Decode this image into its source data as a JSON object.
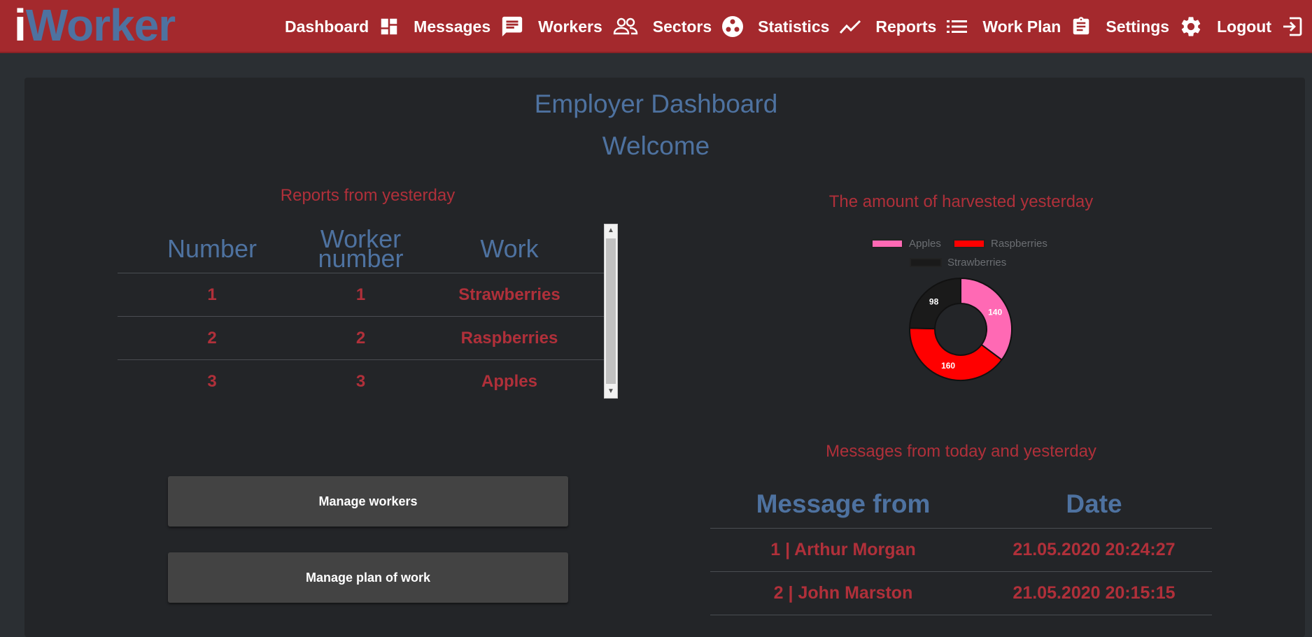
{
  "app": {
    "logo_i": "i",
    "logo_rest": "Worker",
    "colors": {
      "navbar": "#a4292d",
      "accent_blue": "#4e72a0",
      "accent_red": "#b0303a",
      "background": "#2b2f33"
    }
  },
  "nav": {
    "items": [
      {
        "label": "Dashboard",
        "icon": "dashboard-icon"
      },
      {
        "label": "Messages",
        "icon": "message-icon"
      },
      {
        "label": "Workers",
        "icon": "people-icon"
      },
      {
        "label": "Sectors",
        "icon": "sectors-icon"
      },
      {
        "label": "Statistics",
        "icon": "trend-icon"
      },
      {
        "label": "Reports",
        "icon": "list-icon"
      },
      {
        "label": "Work Plan",
        "icon": "clipboard-icon"
      },
      {
        "label": "Settings",
        "icon": "gear-icon"
      },
      {
        "label": "Logout",
        "icon": "logout-icon"
      }
    ]
  },
  "page": {
    "title": "Employer Dashboard",
    "welcome": "Welcome"
  },
  "reports": {
    "title": "Reports from yesterday",
    "headers": {
      "number": "Number",
      "worker_line1": "Worker",
      "worker_line2": "number",
      "work": "Work"
    },
    "rows": [
      {
        "number": "1",
        "worker": "1",
        "work": "Strawberries"
      },
      {
        "number": "2",
        "worker": "2",
        "work": "Raspberries"
      },
      {
        "number": "3",
        "worker": "3",
        "work": "Apples"
      }
    ]
  },
  "buttons": {
    "manage_workers": "Manage workers",
    "manage_plan": "Manage plan of work"
  },
  "harvest": {
    "title": "The amount of harvested yesterday"
  },
  "chart_data": {
    "type": "pie",
    "subtype": "doughnut",
    "title": "",
    "legend_position": "top",
    "labels": [
      "Apples",
      "Raspberries",
      "Strawberries"
    ],
    "values": [
      140,
      160,
      98
    ],
    "colors": [
      "#ff69b4",
      "#ff0000",
      "#1a1a1a"
    ],
    "data_labels": [
      "140",
      "160",
      "98"
    ]
  },
  "messages": {
    "title": "Messages from today and yesterday",
    "headers": {
      "from": "Message from",
      "date": "Date"
    },
    "rows": [
      {
        "from": "1 | Arthur Morgan",
        "date": "21.05.2020 20:24:27"
      },
      {
        "from": "2 | John Marston",
        "date": "21.05.2020 20:15:15"
      }
    ]
  }
}
